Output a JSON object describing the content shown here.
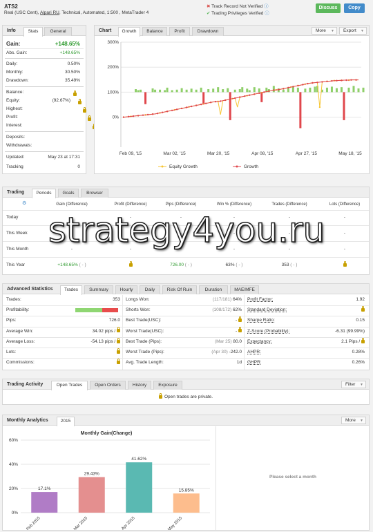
{
  "header": {
    "title": "ATS2",
    "subtitle_prefix": "Real (USC Cent),",
    "broker": "Alpari RU",
    "subtitle_suffix": ", Technical, Automated, 1:500 , MetaTrader 4",
    "track_record": "Track Record Not Verified",
    "trading_privileges": "Trading Privileges Verified",
    "discuss_label": "Discuss",
    "copy_label": "Copy",
    "colors": {
      "green": "#5cb85c",
      "blue": "#428bca",
      "red_x": "#d9534f",
      "check": "#5cb85c"
    }
  },
  "info": {
    "title": "Info",
    "tabs": [
      "Stats",
      "General"
    ],
    "gain_label": "Gain:",
    "gain_value": "+148.65%",
    "abs_gain_label": "Abs. Gain:",
    "abs_gain_value": "+148.65%",
    "daily_label": "Daily:",
    "daily_value": "0.50%",
    "monthly_label": "Monthly:",
    "monthly_value": "30.50%",
    "drawdown_label": "Drawdown:",
    "drawdown_value": "35.49%",
    "balance_label": "Balance:",
    "equity_label": "Equity:",
    "equity_value": "(92.67%)",
    "highest_label": "Highest:",
    "profit_label": "Profit:",
    "interest_label": "Interest:",
    "deposits_label": "Deposits:",
    "withdrawals_label": "Withdrawals:",
    "updated_label": "Updated:",
    "updated_value": "May 23 at 17:31",
    "tracking_label": "Tracking",
    "tracking_value": "0"
  },
  "chart_panel": {
    "title": "Chart",
    "tabs": [
      "Growth",
      "Balance",
      "Profit",
      "Drawdown"
    ],
    "more_label": "More",
    "export_label": "Export"
  },
  "chart_data": {
    "type": "bar",
    "yticks": [
      "300%",
      "200%",
      "100%",
      "0%"
    ],
    "ylim": [
      -120,
      300
    ],
    "x_ticks": [
      "Feb 09, '15",
      "Mar 02, '15",
      "Mar 20, '15",
      "Apr 08, '15",
      "Apr 27, '15",
      "May 18, '15"
    ],
    "legend": [
      "Equity Growth",
      "Growth"
    ],
    "bars": [
      {
        "i": 5,
        "v": 12
      },
      {
        "i": 6,
        "v": 8
      },
      {
        "i": 7,
        "v": 10
      },
      {
        "i": 9,
        "v": -30
      },
      {
        "i": 12,
        "v": 15
      },
      {
        "i": 13,
        "v": 10
      },
      {
        "i": 15,
        "v": 10
      },
      {
        "i": 17,
        "v": 8
      },
      {
        "i": 18,
        "v": 18
      },
      {
        "i": 20,
        "v": 8
      },
      {
        "i": 22,
        "v": 10
      },
      {
        "i": 24,
        "v": 16
      },
      {
        "i": 26,
        "v": 10
      },
      {
        "i": 28,
        "v": 14
      },
      {
        "i": 30,
        "v": 10
      },
      {
        "i": 32,
        "v": 18
      },
      {
        "i": 33,
        "v": -30
      },
      {
        "i": 35,
        "v": 12
      },
      {
        "i": 37,
        "v": 14
      },
      {
        "i": 39,
        "v": 20
      },
      {
        "i": 41,
        "v": 12
      },
      {
        "i": 43,
        "v": 16
      },
      {
        "i": 44,
        "v": -70
      },
      {
        "i": 46,
        "v": 10
      },
      {
        "i": 48,
        "v": 12
      },
      {
        "i": 49,
        "v": 20
      },
      {
        "i": 51,
        "v": 14
      },
      {
        "i": 52,
        "v": 8
      },
      {
        "i": 54,
        "v": 20
      },
      {
        "i": 56,
        "v": 15
      },
      {
        "i": 57,
        "v": -25
      },
      {
        "i": 59,
        "v": 18
      },
      {
        "i": 60,
        "v": 12
      },
      {
        "i": 62,
        "v": 25
      },
      {
        "i": 64,
        "v": 15
      },
      {
        "i": 66,
        "v": 10
      },
      {
        "i": 68,
        "v": 16
      },
      {
        "i": 70,
        "v": 22
      },
      {
        "i": 72,
        "v": 18
      },
      {
        "i": 73,
        "v": -90
      },
      {
        "i": 75,
        "v": 14
      },
      {
        "i": 77,
        "v": 18
      },
      {
        "i": 79,
        "v": 22
      },
      {
        "i": 80,
        "v": 25
      },
      {
        "i": 82,
        "v": 10
      },
      {
        "i": 84,
        "v": 18
      },
      {
        "i": 86,
        "v": 22
      },
      {
        "i": 88,
        "v": 16
      },
      {
        "i": 90,
        "v": 20
      },
      {
        "i": 91,
        "v": -70
      },
      {
        "i": 93,
        "v": 18
      },
      {
        "i": 95,
        "v": 25
      },
      {
        "i": 97,
        "v": 15
      },
      {
        "i": 99,
        "v": 18
      }
    ],
    "growth": [
      0,
      1,
      2,
      3,
      4,
      5,
      6,
      7,
      8,
      9,
      10,
      11,
      12,
      13,
      15,
      17,
      19,
      21,
      23,
      25,
      27,
      29,
      31,
      33,
      35,
      37,
      39,
      41,
      43,
      45,
      47,
      49,
      51,
      53,
      55,
      57,
      59,
      61,
      62,
      63,
      64,
      66,
      68,
      70,
      72,
      74,
      76,
      78,
      80,
      82,
      84,
      86,
      88,
      90,
      92,
      94,
      96,
      98,
      100,
      102,
      104,
      106,
      108,
      109,
      110,
      112,
      114,
      116,
      118,
      120,
      122,
      124,
      126,
      128,
      130,
      132,
      134,
      136,
      137,
      138,
      139,
      140,
      141,
      142,
      143,
      144,
      145,
      146,
      146,
      147,
      147,
      148,
      148,
      148,
      149,
      149,
      149,
      149
    ],
    "equity_dips": [
      {
        "i": 40,
        "v": 10
      },
      {
        "i": 47,
        "v": 40
      },
      {
        "i": 81,
        "v": 40
      }
    ]
  },
  "trading": {
    "title": "Trading",
    "tabs": [
      "Periods",
      "Goals",
      "Browser"
    ],
    "columns": [
      "Gain (Difference)",
      "Profit (Difference)",
      "Pips (Difference)",
      "Win % (Difference)",
      "Trades (Difference)",
      "Lots (Difference)"
    ],
    "rows": [
      {
        "label": "Today",
        "gain": "-",
        "profit": "-",
        "pips": "-",
        "win": "-",
        "trades": "-",
        "lots": "-"
      },
      {
        "label": "This Week",
        "gain": "-",
        "profit": "-",
        "pips": "-",
        "win": "-",
        "trades": "-",
        "lots": "-"
      },
      {
        "label": "This Month",
        "gain": "-",
        "profit": "-",
        "pips": "-",
        "win": "-",
        "trades": "-",
        "lots": "-"
      },
      {
        "label": "This Year",
        "gain": "+148.65%",
        "gain_diff": "( - )",
        "profit": "",
        "pips": "726.00",
        "pips_diff": "( - )",
        "win": "63%",
        "win_diff": "( - )",
        "trades": "353",
        "trades_diff": "( - )",
        "lots": ""
      }
    ]
  },
  "advanced": {
    "title": "Advanced Statistics",
    "tabs": [
      "Trades",
      "Summary",
      "Hourly",
      "Daily",
      "Risk Of Ruin",
      "Duration",
      "MAE/MFE"
    ],
    "col1": [
      {
        "label": "Trades:",
        "value": "353"
      },
      {
        "label": "Profitability:",
        "value": ""
      },
      {
        "label": "Pips:",
        "value": "726.0"
      },
      {
        "label": "Average Win:",
        "value": "34.02 pips /"
      },
      {
        "label": "Average Loss:",
        "value": "-54.13 pips /"
      },
      {
        "label": "Lots:",
        "value": ""
      },
      {
        "label": "Commissions:",
        "value": ""
      }
    ],
    "profitability_win": 0.63,
    "col2": [
      {
        "label": "Longs Won:",
        "sub": "(117/181)",
        "value": "64%"
      },
      {
        "label": "Shorts Won:",
        "sub": "(108/172)",
        "value": "62%"
      },
      {
        "label": "Best Trade(USC):",
        "sub": "",
        "value": "-"
      },
      {
        "label": "Worst Trade(USC):",
        "sub": "",
        "value": "-"
      },
      {
        "label": "Best Trade (Pips):",
        "sub": "(Mar 25)",
        "value": "80.0"
      },
      {
        "label": "Worst Trade (Pips):",
        "sub": "(Apr 30)",
        "value": "-242.0"
      },
      {
        "label": "Avg. Trade Length:",
        "sub": "",
        "value": "1d"
      }
    ],
    "col3": [
      {
        "label": "Profit Factor:",
        "value": "1.92"
      },
      {
        "label": "Standard Deviation:",
        "value": ""
      },
      {
        "label": "Sharpe Ratio:",
        "value": "0.15"
      },
      {
        "label": "Z-Score (Probability):",
        "value": "-6.31 (99.99%)"
      },
      {
        "label": "Expectancy:",
        "value": "2.1 Pips /"
      },
      {
        "label": "AHPR:",
        "value": "0.28%"
      },
      {
        "label": "GHPR:",
        "value": "0.26%"
      }
    ]
  },
  "activity": {
    "title": "Trading Activity",
    "tabs": [
      "Open Trades",
      "Open Orders",
      "History",
      "Exposure"
    ],
    "filter_label": "Filter",
    "message": "Open trades are private."
  },
  "monthly": {
    "title": "Monthly Analytics",
    "tab": "2015",
    "more_label": "More",
    "chart_title": "Monthly Gain(Change)",
    "select_message": "Please select a month",
    "yticks": [
      "60%",
      "40%",
      "20%",
      "0%"
    ],
    "chart": {
      "type": "bar",
      "categories": [
        "Feb 2015",
        "Mar 2015",
        "Apr 2015",
        "May 2015"
      ],
      "values": [
        17.1,
        29.43,
        41.62,
        15.85
      ],
      "labels": [
        "17.1%",
        "29.43%",
        "41.62%",
        "15.85%"
      ],
      "colors": [
        "#b07cc6",
        "#e48f8f",
        "#5ab9b2",
        "#fdbd8d"
      ],
      "ylim": [
        0,
        60
      ]
    }
  }
}
